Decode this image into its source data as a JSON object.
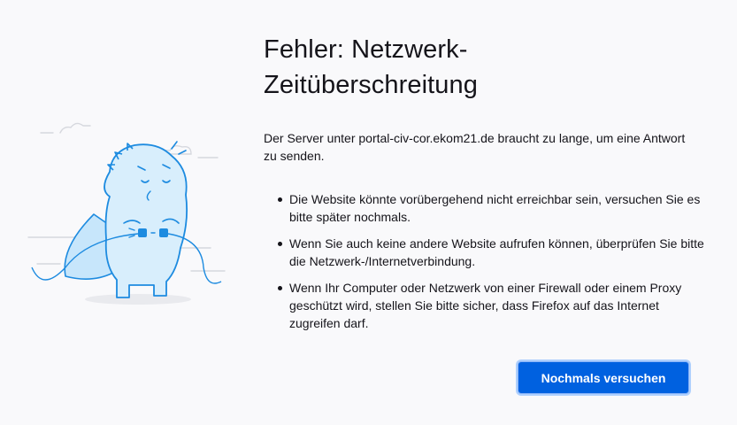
{
  "error": {
    "title_line1": "Fehler: Netzwerk-",
    "title_line2": "Zeitüberschreitung",
    "description": "Der Server unter portal-civ-cor.ekom21.de braucht zu lange, um eine Antwort zu senden.",
    "reasons": [
      "Die Website könnte vorübergehend nicht erreichbar sein, versuchen Sie es bitte später nochmals.",
      "Wenn Sie auch keine andere Website aufrufen können, überprüfen Sie bitte die Netzwerk-/Internetverbindung.",
      "Wenn Ihr Computer oder Netzwerk von einer Firewall oder einem Proxy geschützt wird, stellen Sie bitte sicher, dass Firefox auf das Internet zugreifen darf."
    ]
  },
  "actions": {
    "retry_label": "Nochmals versuchen"
  },
  "illustration": {
    "icon": "unplugged-dino-illustration",
    "stroke_color": "#1d8be0",
    "fill_color": "#d8eefc"
  },
  "colors": {
    "accent": "#0061e0",
    "background": "#f9f9fb",
    "text": "#15141a"
  }
}
